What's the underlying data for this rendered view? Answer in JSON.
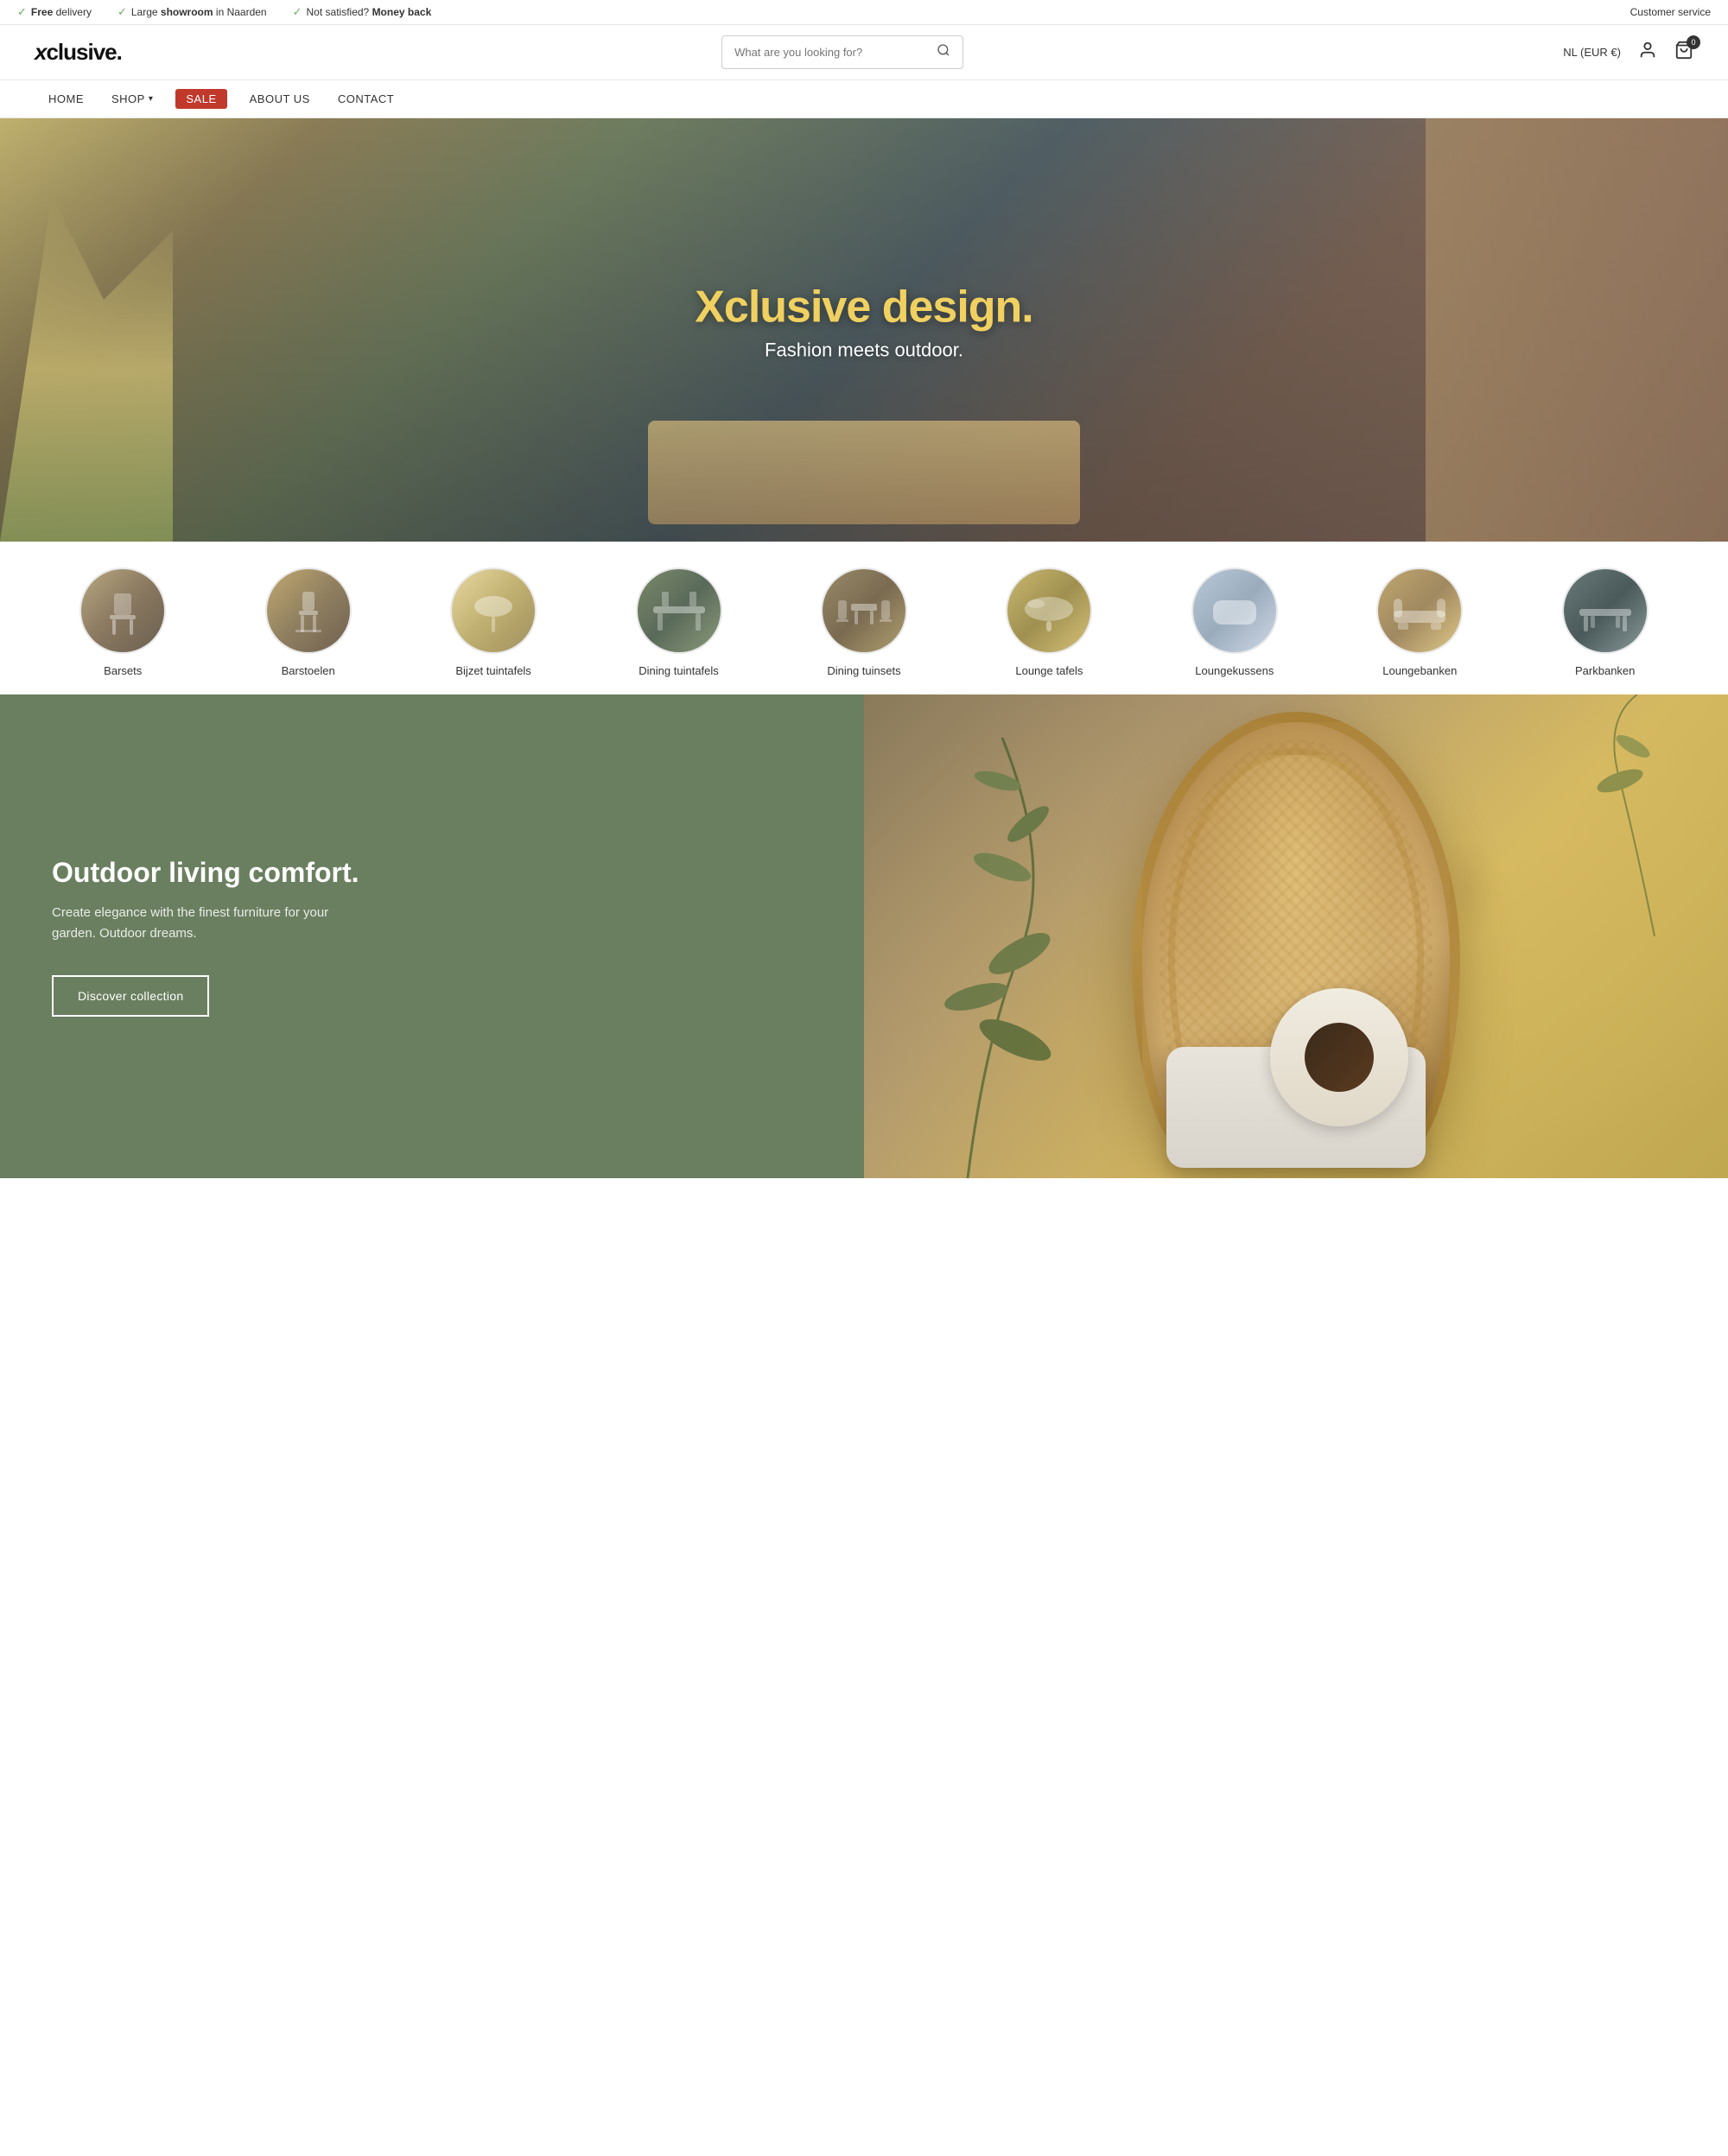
{
  "announcement": {
    "items": [
      {
        "icon": "✓",
        "text_bold": "Free",
        "text_rest": " delivery"
      },
      {
        "icon": "✓",
        "text_bold": "Large showroom",
        "text_rest": " in Naarden"
      },
      {
        "icon": "✓",
        "text_rest": "Not satisfied? ",
        "text_bold2": "Money back"
      }
    ],
    "customer_service": "Customer service"
  },
  "header": {
    "logo": "xclusive.",
    "search_placeholder": "What are you looking for?",
    "lang": "NL (EUR €)",
    "cart_count": "0"
  },
  "nav": {
    "items": [
      {
        "label": "HOME",
        "has_dropdown": false
      },
      {
        "label": "SHOP",
        "has_dropdown": true
      },
      {
        "label": "SALE",
        "is_sale": true
      },
      {
        "label": "ABOUT US",
        "has_dropdown": false
      },
      {
        "label": "CONTACT",
        "has_dropdown": false
      }
    ]
  },
  "hero": {
    "title_part1": "Xclusive",
    "title_highlight": " design.",
    "subtitle": "Fashion meets outdoor."
  },
  "categories": {
    "items": [
      {
        "label": "Barsets",
        "bg_class": "cat-barsets"
      },
      {
        "label": "Barstoelen",
        "bg_class": "cat-barstoelen"
      },
      {
        "label": "Bijzet tuintafels",
        "bg_class": "cat-bijzet"
      },
      {
        "label": "Dining tuintafels",
        "bg_class": "cat-dining-tafels"
      },
      {
        "label": "Dining tuinsets",
        "bg_class": "cat-dining-tuinsets"
      },
      {
        "label": "Lounge tafels",
        "bg_class": "cat-lounge-tafels"
      },
      {
        "label": "Loungekussens",
        "bg_class": "cat-loungekussens"
      },
      {
        "label": "Loungebanken",
        "bg_class": "cat-loungebanken"
      },
      {
        "label": "Parkbanken",
        "bg_class": "cat-parkbanken"
      }
    ]
  },
  "promo": {
    "title": "Outdoor living comfort.",
    "subtitle": "Create elegance with the finest furniture for your garden. Outdoor dreams.",
    "button_label": "Discover collection"
  }
}
